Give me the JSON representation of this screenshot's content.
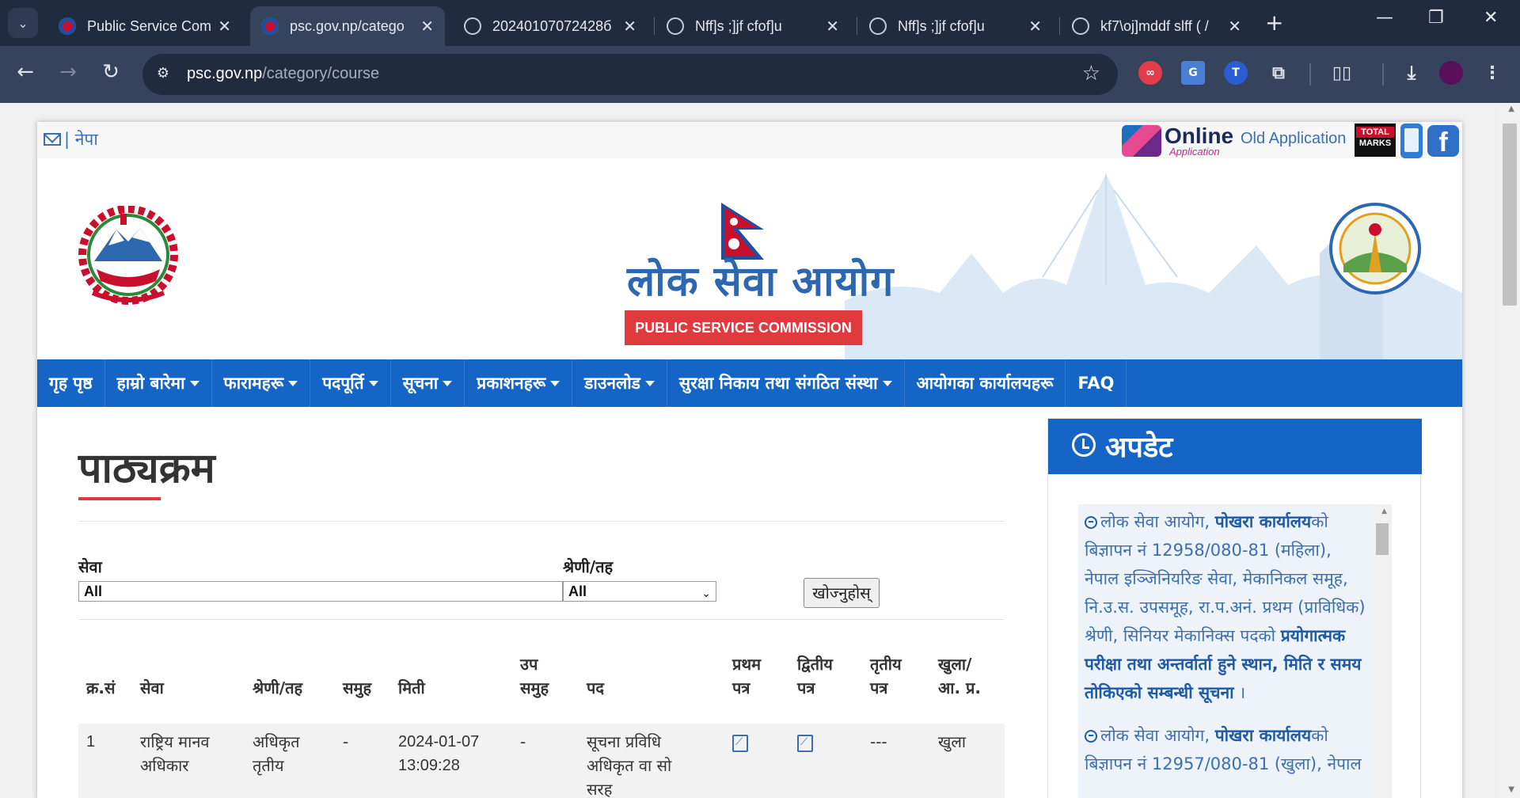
{
  "browser": {
    "tabs": [
      {
        "title": "Public Service Com",
        "favicon": "psc"
      },
      {
        "title": "psc.gov.np/catego",
        "favicon": "psc",
        "active": true
      },
      {
        "title": "20240107072428б",
        "favicon": "globe"
      },
      {
        "title": "Nff]s ;]jf cfof]u",
        "favicon": "globe"
      },
      {
        "title": "Nff]s ;]jf cfof]u",
        "favicon": "globe"
      },
      {
        "title": "kf7\\oj]mddf slff ( /",
        "favicon": "globe"
      }
    ],
    "url_host": "psc.gov.np",
    "url_path": "/category/course",
    "profile_color": "#5a0f5a"
  },
  "site": {
    "top": {
      "lang": "| नेपा",
      "online_title": "Online",
      "online_sub": "Application",
      "old_app": "Old Application",
      "total_marks_1": "TOTAL",
      "total_marks_2": "MARKS"
    },
    "banner": {
      "title_np": "लोक सेवा आयोग",
      "title_en": "PUBLIC SERVICE COMMISSION"
    },
    "nav": [
      {
        "label": "गृह पृष्ठ",
        "dropdown": false
      },
      {
        "label": "हाम्रो बारेमा",
        "dropdown": true
      },
      {
        "label": "फारामहरू",
        "dropdown": true
      },
      {
        "label": "पदपूर्ति",
        "dropdown": true
      },
      {
        "label": "सूचना",
        "dropdown": true
      },
      {
        "label": "प्रकाशनहरू",
        "dropdown": true
      },
      {
        "label": "डाउनलोड",
        "dropdown": true
      },
      {
        "label": "सुरक्षा निकाय तथा संगठित संस्था",
        "dropdown": true
      },
      {
        "label": "आयोगका कार्यालयहरू",
        "dropdown": false
      },
      {
        "label": "FAQ",
        "dropdown": false
      }
    ],
    "main": {
      "page_title": "पाठ्यक्रम",
      "filter_service_label": "सेवा",
      "filter_service_value": "All",
      "filter_level_label": "श्रेणी/तह",
      "filter_level_value": "All",
      "search_button": "खोज्नुहोस्",
      "columns": [
        "क्र.सं",
        "सेवा",
        "श्रेणी/तह",
        "समुह",
        "मिती",
        "उप समुह",
        "पद",
        "प्रथम पत्र",
        "द्वितीय पत्र",
        "तृतीय पत्र",
        "खुला/ आ. प्र."
      ],
      "rows": [
        {
          "sn": "1",
          "service": "राष्ट्रिय मानव अधिकार",
          "level": "अधिकृत तृतीय",
          "group": "-",
          "date": "2024-01-07 13:09:28",
          "subgroup": "-",
          "post": "सूचना प्रविधि अधिकृत वा सो सरह",
          "paper3": "---",
          "type": "खुला"
        }
      ]
    },
    "updates": {
      "heading": "अपडेट",
      "items": [
        {
          "pre": "लोक सेवा आयोग, ",
          "office": "पोखरा कार्यालय",
          "mid": "को बिज्ञापन नं 12958/080-81 (महिला), नेपाल इञ्जिनियरिङ सेवा, मेकानिकल समूह, नि.उ.स. उपसमूह, रा.प.अनं. प्रथम (प्राविधिक) श्रेणी, सिनियर मेकानिक्स पदको ",
          "bold": "प्रयोगात्मक परीक्षा तथा अन्तर्वार्ता हुने स्थान, मिति र समय तोकिएको सम्बन्धी सूचना",
          "end": " ।"
        },
        {
          "pre": "लोक सेवा आयोग, ",
          "office": "पोखरा कार्यालय",
          "mid": "को बिज्ञापन नं 12957/080-81 (खुला), नेपाल",
          "bold": "",
          "end": ""
        }
      ]
    }
  }
}
